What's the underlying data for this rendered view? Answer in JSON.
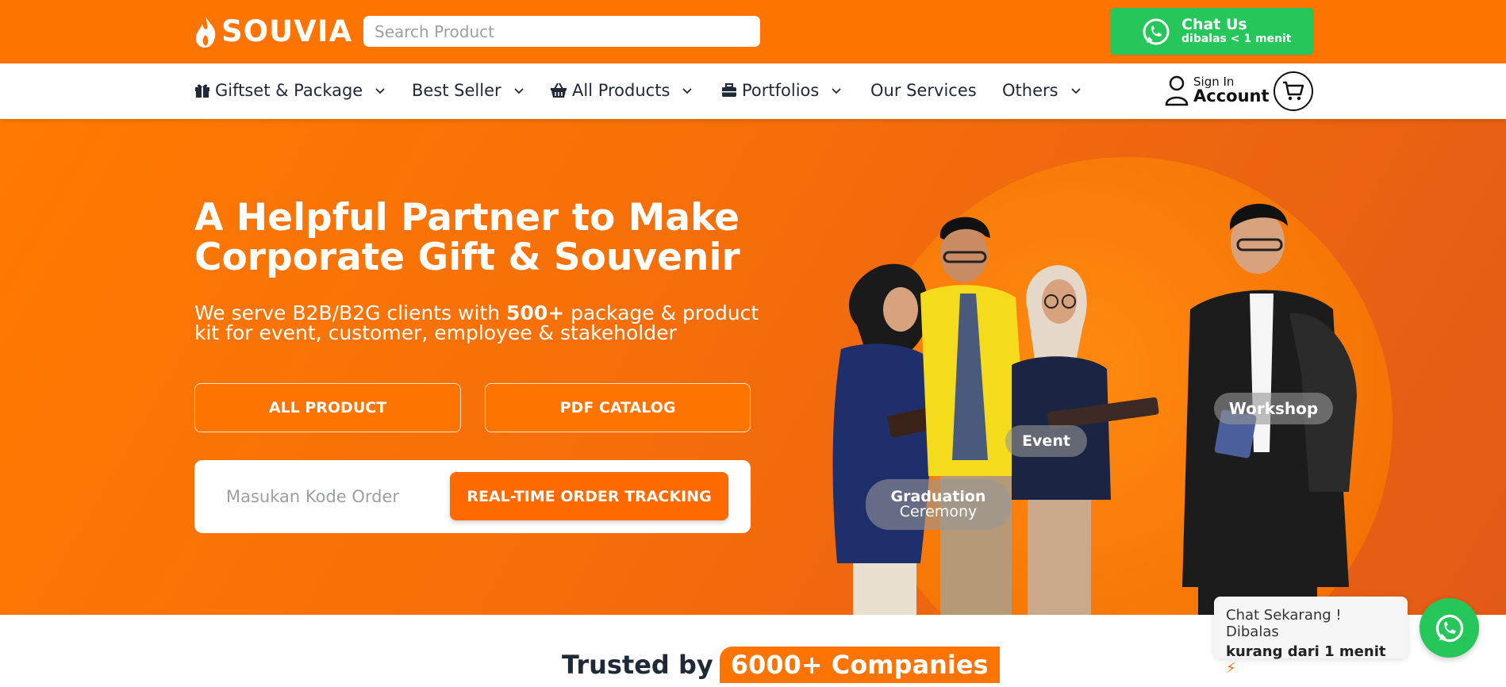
{
  "topbar": {
    "logo_text": "SOUVIA",
    "search_placeholder": "Search Product",
    "chat_title": "Chat Us",
    "chat_subtitle": "dibalas < 1 menit"
  },
  "nav": {
    "items": [
      {
        "label": "Giftset & Package",
        "icon": "gift-icon",
        "dropdown": true
      },
      {
        "label": "Best Seller",
        "icon": "",
        "dropdown": true
      },
      {
        "label": "All Products",
        "icon": "basket-icon",
        "dropdown": true
      },
      {
        "label": "Portfolios",
        "icon": "briefcase-icon",
        "dropdown": true
      },
      {
        "label": "Our Services",
        "icon": "",
        "dropdown": false
      },
      {
        "label": "Others",
        "icon": "",
        "dropdown": true
      }
    ],
    "account_line1": "Sign In",
    "account_line2": "Account"
  },
  "hero": {
    "title": "A Helpful Partner to Make Corporate Gift & Souvenir",
    "subtitle_pre": "We serve B2B/B2G clients with ",
    "subtitle_bold": "500+",
    "subtitle_post": " package & product kit for event, customer, employee & stakeholder",
    "btn_all_product": "ALL PRODUCT",
    "btn_pdf_catalog": "PDF CATALOG",
    "track_placeholder": "Masukan Kode Order",
    "track_button": "REAL-TIME ORDER TRACKING",
    "tags": {
      "workshop": "Workshop",
      "event": "Event",
      "graduation_1": "Graduation",
      "graduation_2": "Ceremony"
    }
  },
  "trusted": {
    "prefix": "Trusted by",
    "highlight": "6000+ Companies"
  },
  "float_chat": {
    "line1": "Chat Sekarang ! Dibalas",
    "line2": "kurang dari 1 menit"
  },
  "colors": {
    "brand_orange": "#ff7300",
    "whatsapp_green": "#25c65a"
  }
}
